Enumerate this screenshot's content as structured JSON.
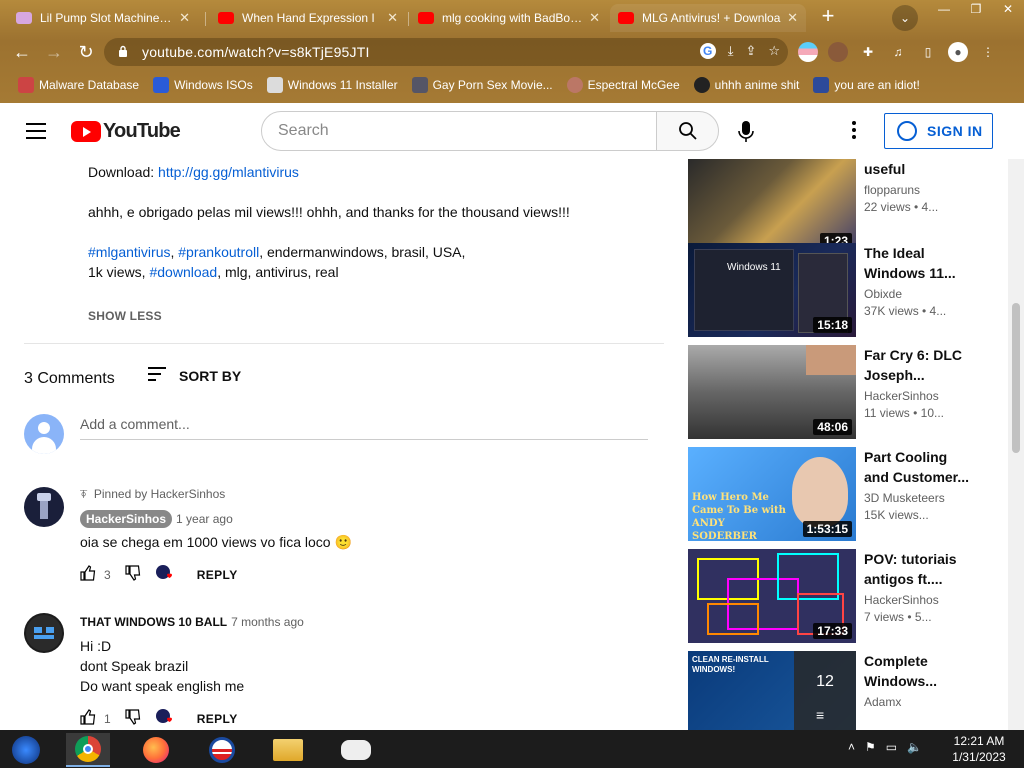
{
  "browser": {
    "tabs": [
      {
        "title": "Lil Pump Slot Machine - W",
        "favicon": "slot-machine-icon"
      },
      {
        "title": "When Hand Expression I",
        "favicon": "youtube-icon"
      },
      {
        "title": "mlg cooking with BadBoyH",
        "favicon": "youtube-icon"
      },
      {
        "title": "MLG Antivirus! + Downloa",
        "favicon": "youtube-icon"
      }
    ],
    "new_tab": "+",
    "url": "youtube.com/watch?v=s8kTjE95JTI",
    "bookmarks": [
      {
        "label": "Malware Database",
        "icon": "folder-icon",
        "color": "#c44"
      },
      {
        "label": "Windows ISOs",
        "icon": "x-icon",
        "color": "#2a5bd7"
      },
      {
        "label": "Windows 11 Installer",
        "icon": "image-icon",
        "color": "#dcdcdc"
      },
      {
        "label": "Gay Porn Sex Movie...",
        "icon": "bookmark-icon",
        "color": "#556"
      },
      {
        "label": "Espectral McGee",
        "icon": "avatar-icon",
        "color": "#b76"
      },
      {
        "label": "uhhh anime shit",
        "icon": "avatar-icon",
        "color": "#222"
      },
      {
        "label": "you are an idiot!",
        "icon": "flag-icon",
        "color": "#2c4a9a"
      }
    ]
  },
  "youtube": {
    "logo_text": "YouTube",
    "search_placeholder": "Search",
    "signin_label": "SIGN IN"
  },
  "description": {
    "download_prefix": "Download: ",
    "download_link": "http://gg.gg/mlantivirus",
    "thanks": "ahhh, e obrigado pelas mil views!!! ohhh, and thanks for the thousand views!!!",
    "tag1": "#mlgantivirus",
    "sep1": ", ",
    "tag2": "#prankoutroll",
    "tags_rest": ", endermanwindows, brasil, USA,",
    "line4_prefix": "1k views, ",
    "tag3": "#download",
    "line4_rest": ", mlg, antivirus, real",
    "show_less": "SHOW LESS"
  },
  "comments_header": {
    "count": "3 Comments",
    "sort_label": "SORT BY",
    "add_placeholder": "Add a comment..."
  },
  "comments": [
    {
      "pinned": "Pinned by HackerSinhos",
      "author": "HackerSinhos",
      "ago": "1 year ago",
      "text": "oia se chega em 1000 views vo fica loco 🙂",
      "likes": "3",
      "reply": "REPLY"
    },
    {
      "author": "THAT WINDOWS 10 BALL",
      "ago": "7 months ago",
      "lines": [
        "Hi :D",
        "dont Speak brazil",
        "Do want speak english me"
      ],
      "likes": "1",
      "reply": "REPLY"
    }
  ],
  "sidebar": [
    {
      "title": "useful",
      "channel": "flopparuns",
      "meta": "22 views • 4...",
      "duration": "1:23",
      "thumb_color": "#4a3a2a"
    },
    {
      "title": "The Ideal Windows 11...",
      "channel": "Obixde",
      "meta": "37K views • 4...",
      "duration": "15:18",
      "thumb_color": "#1a1a2a",
      "thumb_label": "Windows 11"
    },
    {
      "title": "Far Cry 6: DLC Joseph...",
      "channel": "HackerSinhos",
      "meta": "11 views • 10...",
      "duration": "48:06",
      "thumb_color": "#777"
    },
    {
      "title": "Part Cooling and Customer...",
      "channel": "3D Musketeers",
      "meta": "15K views...",
      "duration": "1:53:15",
      "thumb_color": "#3a8fd0",
      "thumb_label": "How Hero Me Came To Be with ANDY SODERBER"
    },
    {
      "title": "POV: tutoriais antigos ft....",
      "channel": "HackerSinhos",
      "meta": "7 views • 5...",
      "duration": "17:33",
      "thumb_color": "#303060"
    },
    {
      "title": "Complete Windows...",
      "channel": "Adamx",
      "meta": "",
      "duration": "12",
      "thumb_color": "#1a4a8a",
      "thumb_label": "CLEAN RE-INSTALL WINDOWS!"
    }
  ],
  "taskbar": {
    "time": "12:21 AM",
    "date": "1/31/2023"
  }
}
